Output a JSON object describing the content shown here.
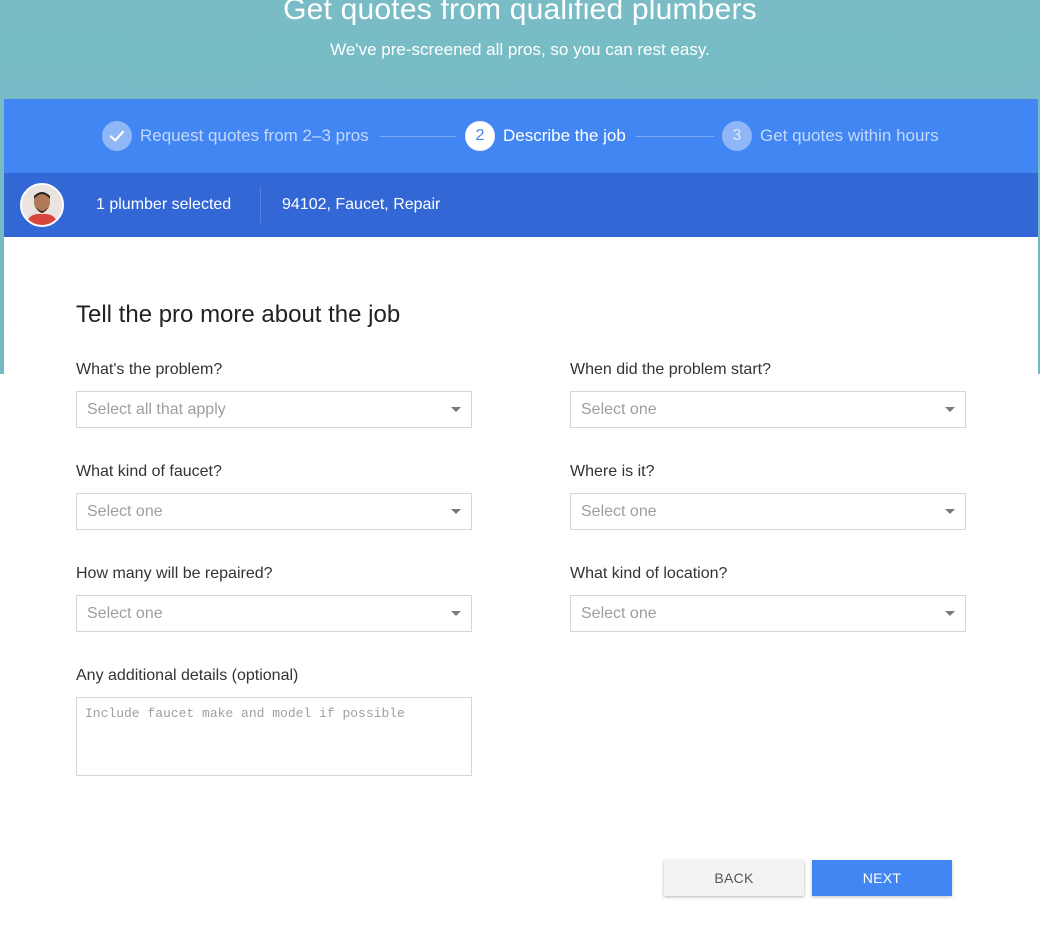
{
  "hero": {
    "title": "Get quotes from qualified plumbers",
    "subtitle": "We've pre-screened all pros, so you can rest easy."
  },
  "steps": [
    {
      "number": "",
      "label": "Request quotes from 2–3 pros",
      "state": "done"
    },
    {
      "number": "2",
      "label": "Describe the job",
      "state": "active"
    },
    {
      "number": "3",
      "label": "Get quotes within hours",
      "state": "todo"
    }
  ],
  "summary": {
    "pro_count": "1 plumber selected",
    "details": "94102, Faucet, Repair"
  },
  "form": {
    "title": "Tell the pro more about the job",
    "fields": [
      {
        "label": "What's the problem?",
        "value": "Select all that apply"
      },
      {
        "label": "When did the problem start?",
        "value": "Select one"
      },
      {
        "label": "What kind of faucet?",
        "value": "Select one"
      },
      {
        "label": "Where is it?",
        "value": "Select one"
      },
      {
        "label": "How many will be repaired?",
        "value": "Select one"
      },
      {
        "label": "What kind of location?",
        "value": "Select one"
      }
    ],
    "details_label": "Any additional details (optional)",
    "details_placeholder": "Include faucet make and model if possible"
  },
  "buttons": {
    "back": "BACK",
    "next": "NEXT"
  },
  "colors": {
    "hero": "#79bcc6",
    "steps_bar": "#4286f4",
    "summary_bar": "#3367d6",
    "primary": "#4286f4"
  }
}
